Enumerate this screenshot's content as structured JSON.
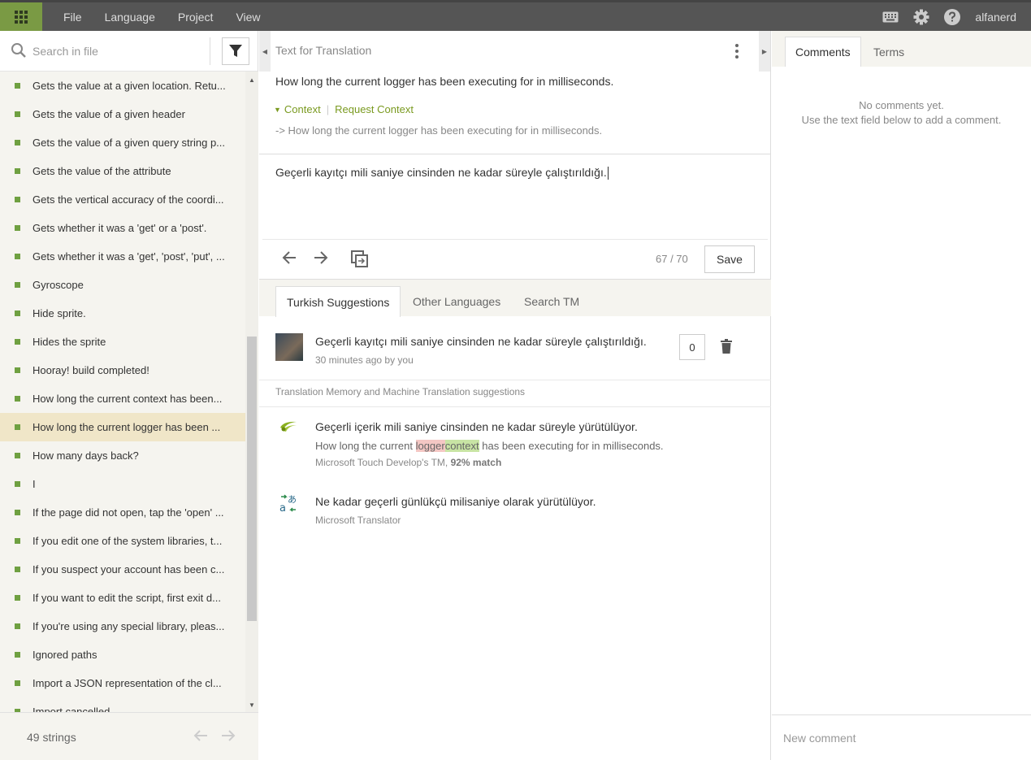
{
  "menu": {
    "items": [
      "File",
      "Language",
      "Project",
      "View"
    ]
  },
  "user": {
    "name": "alfanerd"
  },
  "search": {
    "placeholder": "Search in file"
  },
  "strings": [
    "Gets the value at a given location. Retu...",
    "Gets the value of a given header",
    "Gets the value of a given query string p...",
    "Gets the value of the attribute",
    "Gets the vertical accuracy of the coordi...",
    "Gets whether it was a 'get' or a 'post'.",
    "Gets whether it was a 'get', 'post', 'put', ...",
    "Gyroscope",
    "Hide sprite.",
    "Hides the sprite",
    "Hooray! build completed!",
    "How long the current context has been...",
    "How long the current logger has been ...",
    "How many days back?",
    "I",
    "If the page did not open, tap the 'open' ...",
    "If you edit one of the system libraries, t...",
    "If you suspect your account has been c...",
    "If you want to edit the script, first exit d...",
    "If you're using any special library, pleas...",
    "Ignored paths",
    "Import a JSON representation of the cl...",
    "Import cancelled."
  ],
  "selected_index": 12,
  "footer": {
    "count": "49 strings"
  },
  "editor": {
    "header": "Text for Translation",
    "source": "How long the current logger has been executing for in milliseconds.",
    "context_label": "Context",
    "request_context": "Request Context",
    "context_detail": "-> How long the current logger has been executing for in milliseconds.",
    "translation": "Geçerli kayıtçı mili saniye cinsinden ne kadar süreyle çalıştırıldığı.",
    "counter": "67 / 70",
    "save_label": "Save"
  },
  "tabs": [
    "Turkish Suggestions",
    "Other Languages",
    "Search TM"
  ],
  "suggestion": {
    "text": "Geçerli kayıtçı mili saniye cinsinden ne kadar süreyle çalıştırıldığı.",
    "meta": "30 minutes ago by you",
    "votes": "0"
  },
  "tm_header": "Translation Memory and Machine Translation suggestions",
  "tm": {
    "text": "Geçerli içerik mili saniye cinsinden ne kadar süreyle yürütülüyor.",
    "source_before": "How long the current ",
    "source_del": "logger",
    "source_ins": "context",
    "source_after": " has been executing for in milliseconds.",
    "meta_name": "Microsoft Touch Develop's TM, ",
    "meta_match": "92% match"
  },
  "mt": {
    "text": "Ne kadar geçerli günlükçü milisaniye olarak yürütülüyor.",
    "meta": "Microsoft Translator"
  },
  "right": {
    "tabs": [
      "Comments",
      "Terms"
    ],
    "no_comments_1": "No comments yet.",
    "no_comments_2": "Use the text field below to add a comment.",
    "comment_placeholder": "New comment"
  },
  "colors": {
    "accent": "#7a9a44",
    "status_dot": "#6fa041",
    "selected_row": "#f0e6c8",
    "topbar": "#555555"
  }
}
